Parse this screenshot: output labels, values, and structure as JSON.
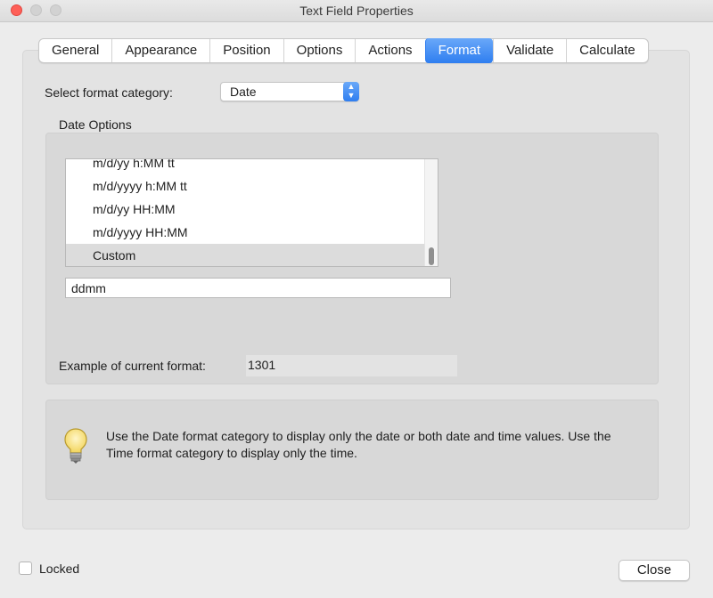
{
  "window": {
    "title": "Text Field Properties"
  },
  "tabs": [
    {
      "label": "General"
    },
    {
      "label": "Appearance"
    },
    {
      "label": "Position"
    },
    {
      "label": "Options"
    },
    {
      "label": "Actions"
    },
    {
      "label": "Format",
      "active": true
    },
    {
      "label": "Validate"
    },
    {
      "label": "Calculate"
    }
  ],
  "format": {
    "category_label": "Select format category:",
    "category_value": "Date"
  },
  "date_options": {
    "group_label": "Date Options",
    "items": [
      "m/d/yy h:MM tt",
      "m/d/yyyy h:MM tt",
      "m/d/yy HH:MM",
      "m/d/yyyy HH:MM",
      "Custom"
    ],
    "selected": "Custom",
    "custom_value": "ddmm",
    "example_label": "Example of current format:",
    "example_value": "1301"
  },
  "hint": {
    "icon": "lightbulb-icon",
    "text": "Use the Date format category to display only the date or both date and time values. Use the Time format category to display only the time."
  },
  "footer": {
    "locked_label": "Locked",
    "locked_checked": false,
    "close_label": "Close"
  },
  "colors": {
    "accent": "#2f7ef0",
    "accent_light": "#69a8f9",
    "close_light": "#fe5f57"
  }
}
